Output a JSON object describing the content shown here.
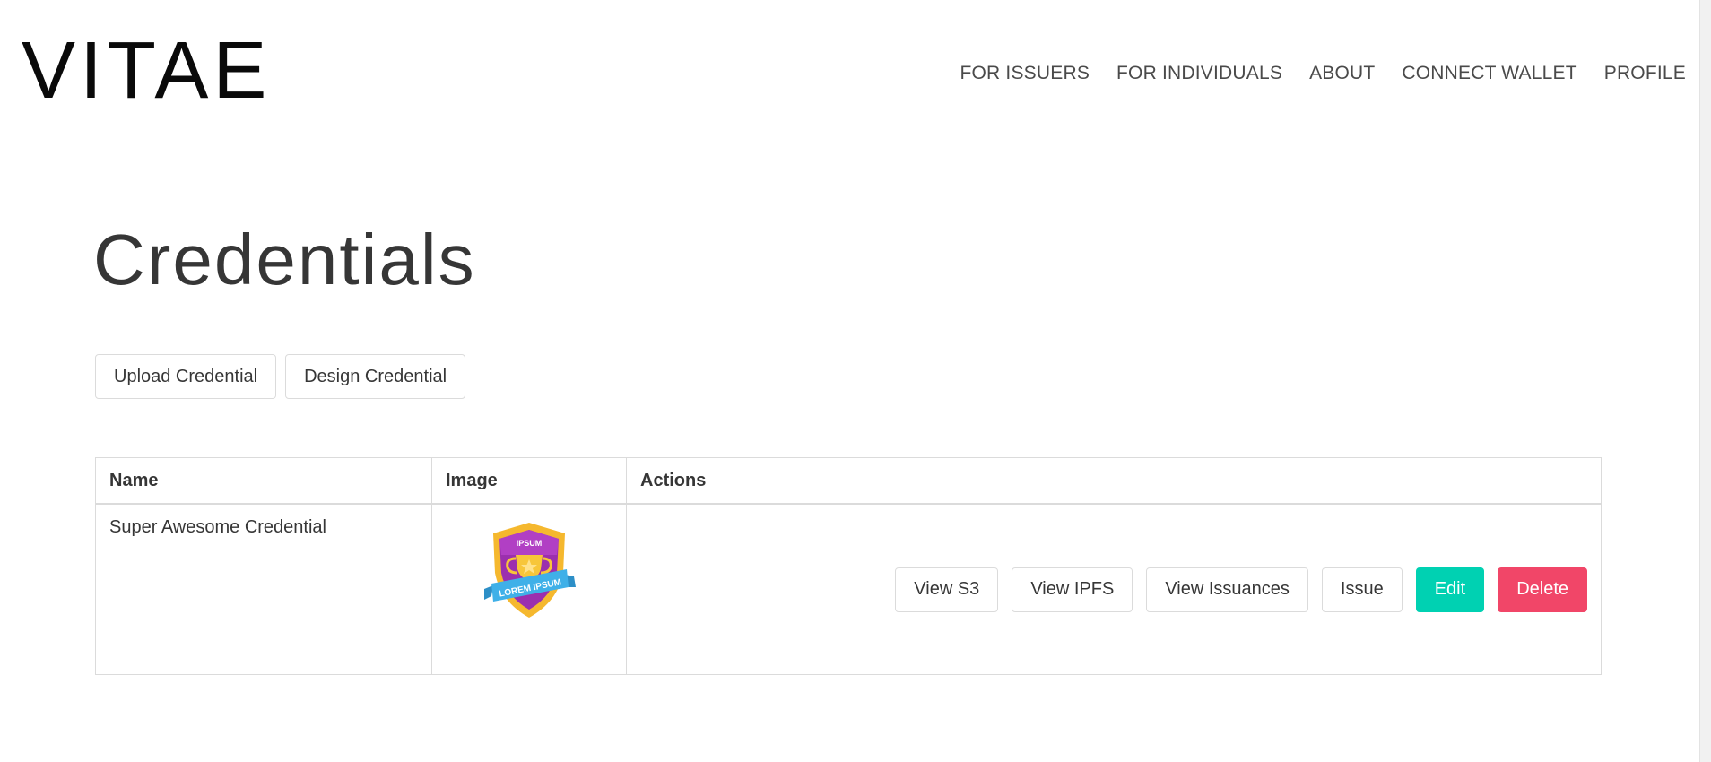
{
  "header": {
    "logo": "VITAE",
    "nav": [
      {
        "label": "FOR ISSUERS"
      },
      {
        "label": "FOR INDIVIDUALS"
      },
      {
        "label": "ABOUT"
      },
      {
        "label": "CONNECT WALLET"
      },
      {
        "label": "PROFILE"
      }
    ]
  },
  "main": {
    "title": "Credentials",
    "upload_label": "Upload Credential",
    "design_label": "Design Credential"
  },
  "table": {
    "columns": [
      "Name",
      "Image",
      "Actions"
    ],
    "rows": [
      {
        "name": "Super Awesome Credential",
        "image_icon": "trophy-badge-icon",
        "badge_text_top": "IPSUM",
        "badge_text_ribbon": "LOREM IPSUM",
        "actions": {
          "view_s3": "View S3",
          "view_ipfs": "View IPFS",
          "view_issuances": "View Issuances",
          "issue": "Issue",
          "edit": "Edit",
          "delete": "Delete"
        }
      }
    ]
  },
  "colors": {
    "primary": "#00d1b2",
    "danger": "#f14668",
    "text": "#363636",
    "border": "#dbdbdb"
  }
}
